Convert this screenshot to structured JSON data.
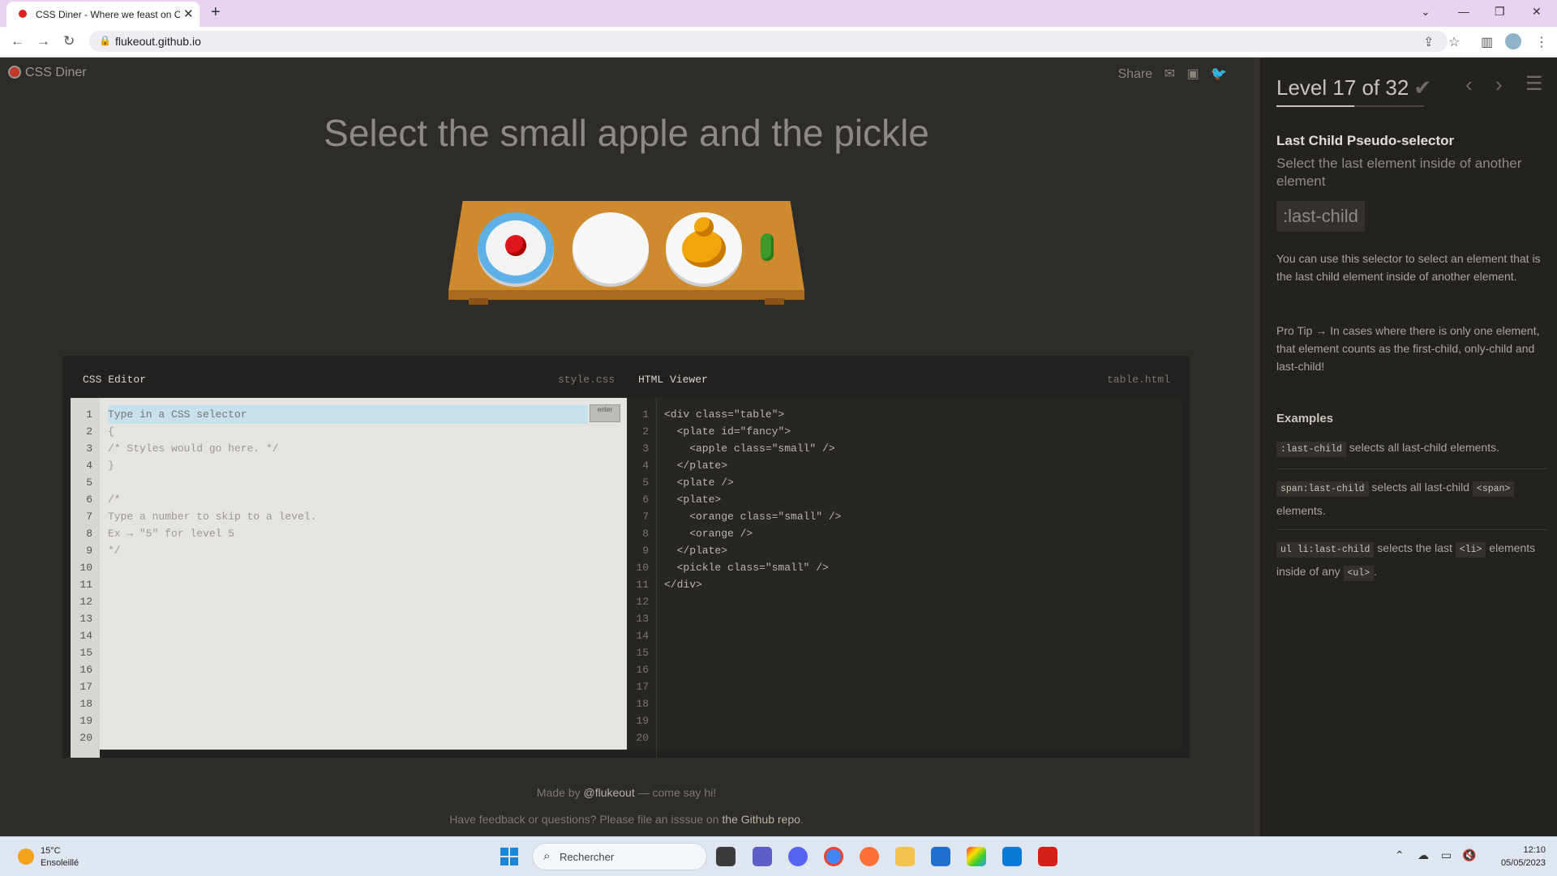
{
  "browser": {
    "tab_title": "CSS Diner - Where we feast on C",
    "new_tab": "+",
    "url": "flukeout.github.io"
  },
  "page": {
    "logo": "CSS Diner",
    "share": "Share",
    "order": "Select the small apple and the pickle"
  },
  "editor": {
    "css_title": "CSS Editor",
    "css_file": "style.css",
    "html_title": "HTML Viewer",
    "html_file": "table.html",
    "placeholder": "Type in a CSS selector",
    "enter": "enter",
    "line_numbers": [
      "1",
      "2",
      "3",
      "4",
      "5",
      "6",
      "7",
      "8",
      "9",
      "10",
      "11",
      "12",
      "13",
      "14",
      "15",
      "16",
      "17",
      "18",
      "19",
      "20"
    ],
    "css_lines": [
      "",
      "{",
      "/* Styles would go here. */",
      "}",
      "",
      "/*",
      "Type a number to skip to a level.",
      "Ex → \"5\" for level 5",
      "*/"
    ],
    "html_lines": [
      "<div class=\"table\">",
      "  <plate id=\"fancy\">",
      "    <apple class=\"small\" />",
      "  </plate>",
      "  <plate />",
      "  <plate>",
      "    <orange class=\"small\" />",
      "    <orange />",
      "  </plate>",
      "  <pickle class=\"small\" />",
      "</div>"
    ]
  },
  "footer": {
    "made_by_pre": "Made by ",
    "made_by_link": "@flukeout",
    "made_by_post": " — come say hi!",
    "feedback_pre": "Have feedback or questions? Please file an isssue on ",
    "feedback_link": "the Github repo",
    "feedback_post": "."
  },
  "sidebar": {
    "level": "Level 17 of 32",
    "level_progress": 0.53,
    "title": "Last Child Pseudo-selector",
    "subtitle": "Select the last element inside of another element",
    "syntax": ":last-child",
    "description": "You can use this selector to select an element that is the last child element inside of another element.",
    "tip": "Pro Tip → In cases where there is only one element, that element counts as the first-child, only-child and last-child!",
    "examples_heading": "Examples",
    "examples": [
      {
        "code": ":last-child",
        "text": " selects all last-child elements.",
        "code2": "",
        "text2": ""
      },
      {
        "code": "span:last-child",
        "text": " selects all last-child ",
        "code2": "<span>",
        "text2": " elements."
      },
      {
        "code": "ul li:last-child",
        "text": " selects the last ",
        "code2": "<li>",
        "text2": " elements inside of any ",
        "code3": "<ul>",
        "text3": "."
      }
    ]
  },
  "taskbar": {
    "temp": "15°C",
    "weather": "Ensoleillé",
    "search": "Rechercher",
    "time": "12:10",
    "date": "05/05/2023"
  },
  "colors": {
    "accent": "#e8d3f2",
    "page_bg": "#2e2c29",
    "input_highlight": "#c6e0ec"
  }
}
